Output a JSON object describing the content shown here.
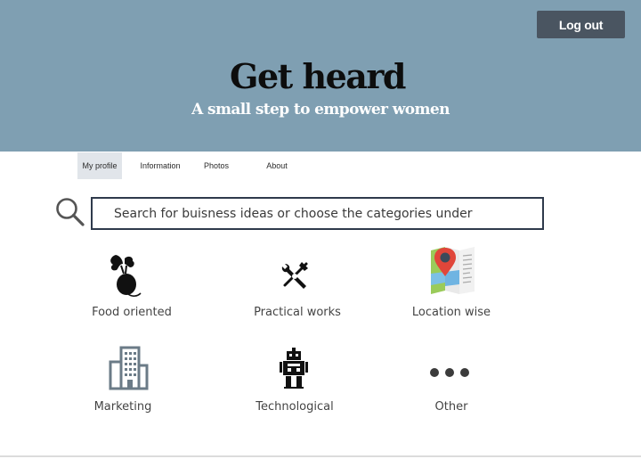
{
  "header": {
    "logout_label": "Log out",
    "title": "Get heard",
    "subtitle": "A small step to empower women",
    "background_color": "#7f9fb2"
  },
  "nav": {
    "items": [
      {
        "label": "My profile",
        "active": true
      },
      {
        "label": "Information",
        "active": false
      },
      {
        "label": "Photos",
        "active": false
      },
      {
        "label": "About",
        "active": false
      }
    ]
  },
  "search": {
    "icon": "search-icon",
    "placeholder": "Search for buisness ideas or choose the categories under"
  },
  "categories": [
    {
      "label": "Food oriented",
      "icon": "beet-icon"
    },
    {
      "label": "Practical works",
      "icon": "tools-icon"
    },
    {
      "label": "Location wise",
      "icon": "map-pin-icon"
    },
    {
      "label": "Marketing",
      "icon": "building-icon"
    },
    {
      "label": "Technological",
      "icon": "robot-icon"
    },
    {
      "label": "Other",
      "icon": "more-dots-icon"
    }
  ]
}
